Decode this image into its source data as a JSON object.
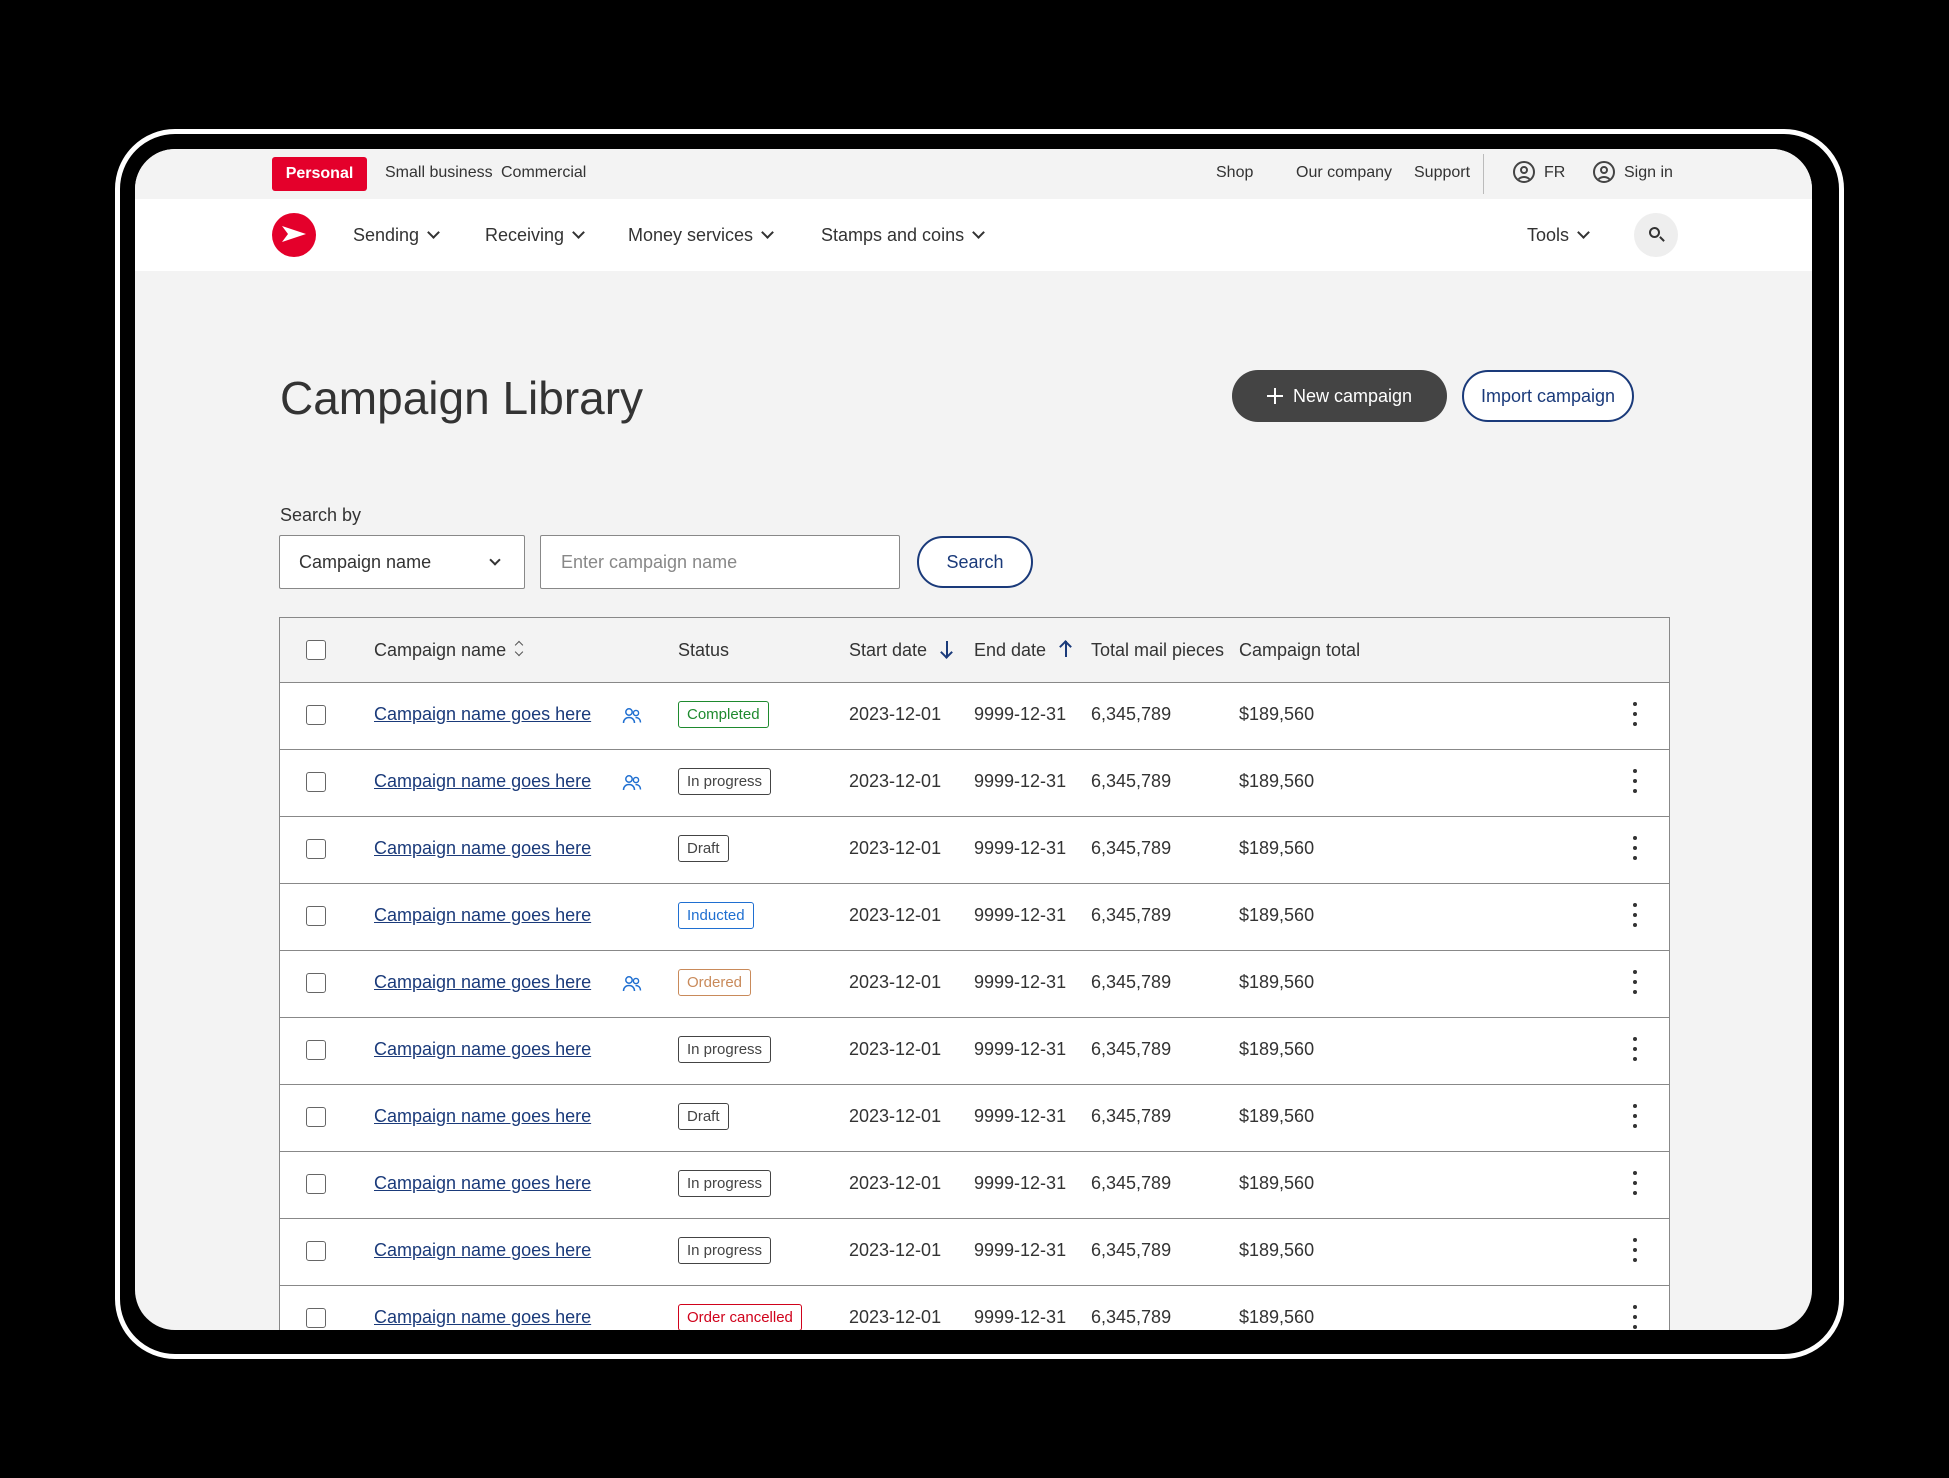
{
  "utility_bar": {
    "segments": [
      "Personal",
      "Small business",
      "Commercial"
    ],
    "links": [
      "Shop",
      "Our company",
      "Support"
    ],
    "language": "FR",
    "sign_in": "Sign in"
  },
  "main_nav": {
    "items": [
      "Sending",
      "Receiving",
      "Money services",
      "Stamps and coins"
    ],
    "tools": "Tools"
  },
  "page": {
    "title": "Campaign Library",
    "new_campaign": "New campaign",
    "import_campaign": "Import campaign"
  },
  "search": {
    "label": "Search by",
    "select_value": "Campaign name",
    "placeholder": "Enter campaign name",
    "button": "Search"
  },
  "table": {
    "headers": [
      "Campaign name",
      "Status",
      "Start date",
      "End date",
      "Total mail pieces",
      "Campaign total"
    ],
    "rows": [
      {
        "name": "Campaign name goes here",
        "shared": true,
        "status": "Completed",
        "start": "2023-12-01",
        "end": "9999-12-31",
        "pieces": "6,345,789",
        "total": "$189,560"
      },
      {
        "name": "Campaign name goes here",
        "shared": true,
        "status": "In progress",
        "start": "2023-12-01",
        "end": "9999-12-31",
        "pieces": "6,345,789",
        "total": "$189,560"
      },
      {
        "name": "Campaign name goes here",
        "shared": false,
        "status": "Draft",
        "start": "2023-12-01",
        "end": "9999-12-31",
        "pieces": "6,345,789",
        "total": "$189,560"
      },
      {
        "name": "Campaign name goes here",
        "shared": false,
        "status": "Inducted",
        "start": "2023-12-01",
        "end": "9999-12-31",
        "pieces": "6,345,789",
        "total": "$189,560"
      },
      {
        "name": "Campaign name goes here",
        "shared": true,
        "status": "Ordered",
        "start": "2023-12-01",
        "end": "9999-12-31",
        "pieces": "6,345,789",
        "total": "$189,560"
      },
      {
        "name": "Campaign name goes here",
        "shared": false,
        "status": "In progress",
        "start": "2023-12-01",
        "end": "9999-12-31",
        "pieces": "6,345,789",
        "total": "$189,560"
      },
      {
        "name": "Campaign name goes here",
        "shared": false,
        "status": "Draft",
        "start": "2023-12-01",
        "end": "9999-12-31",
        "pieces": "6,345,789",
        "total": "$189,560"
      },
      {
        "name": "Campaign name goes here",
        "shared": false,
        "status": "In progress",
        "start": "2023-12-01",
        "end": "9999-12-31",
        "pieces": "6,345,789",
        "total": "$189,560"
      },
      {
        "name": "Campaign name goes here",
        "shared": false,
        "status": "In progress",
        "start": "2023-12-01",
        "end": "9999-12-31",
        "pieces": "6,345,789",
        "total": "$189,560"
      },
      {
        "name": "Campaign name goes here",
        "shared": false,
        "status": "Order cancelled",
        "start": "2023-12-01",
        "end": "9999-12-31",
        "pieces": "6,345,789",
        "total": "$189,560"
      }
    ]
  },
  "status_colors": {
    "Completed": "#1e8a2e",
    "In progress": "#444444",
    "Draft": "#444444",
    "Inducted": "#1f6fd1",
    "Ordered": "#c98a5a",
    "Order cancelled": "#d0021b"
  },
  "colors": {
    "brand_red": "#e4002b",
    "link_blue": "#1a3a7a"
  }
}
